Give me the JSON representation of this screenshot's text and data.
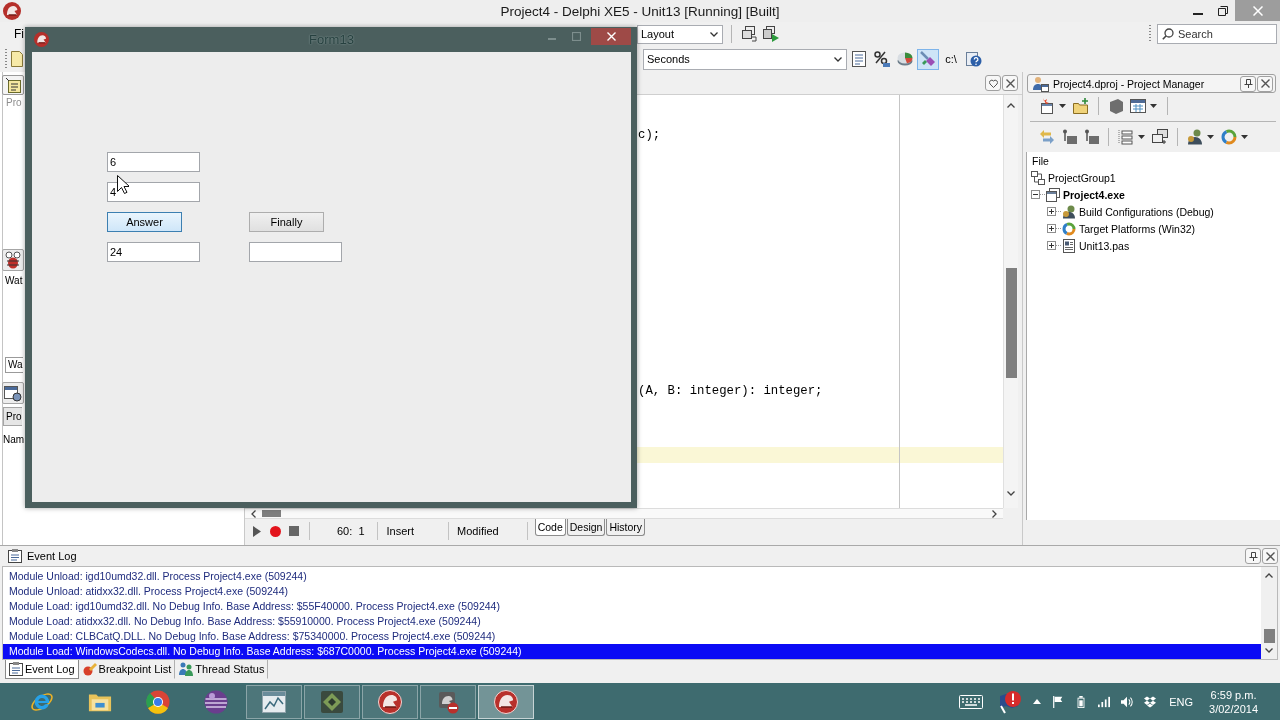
{
  "window": {
    "title": "Project4 - Delphi XE5 - Unit13 [Running] [Built]"
  },
  "menu_bar": {
    "items": [
      "Fi"
    ]
  },
  "toolbar": {
    "layout_combo": {
      "value": "Layout"
    },
    "search": {
      "placeholder": "Search"
    }
  },
  "debug_toolbar": {
    "combo": {
      "value": "Seconds"
    },
    "buttons": [
      {
        "kind": "page",
        "selected": false
      },
      {
        "kind": "percent",
        "selected": false
      },
      {
        "kind": "pie",
        "selected": false
      },
      {
        "kind": "tools",
        "selected": true
      },
      {
        "kind": "text",
        "label": "c:\\",
        "selected": false
      },
      {
        "kind": "help",
        "selected": false
      }
    ]
  },
  "left_strip": [
    {
      "kind": "dim",
      "text": "Pro"
    },
    {
      "kind": "caption",
      "text": "Wat"
    },
    {
      "kind": "tab",
      "text": "Wa"
    },
    {
      "kind": "button",
      "text": "Pro"
    },
    {
      "kind": "caption",
      "text": "Nam"
    }
  ],
  "form": {
    "title": "Form13",
    "rows": [
      [
        {
          "kind": "edit",
          "value": "6"
        }
      ],
      [
        {
          "kind": "edit",
          "value": "4"
        }
      ],
      [
        {
          "kind": "button",
          "label": "Answer",
          "focused": true
        },
        {
          "kind": "button",
          "label": "Finally",
          "focused": false
        }
      ],
      [
        {
          "kind": "edit",
          "value": "24"
        },
        {
          "kind": "edit"
        }
      ]
    ]
  },
  "editor": {
    "code_lines": [
      {
        "text": "c);"
      },
      {
        "text": "(A, B: integer): integer;"
      }
    ],
    "status_bar": {
      "cursor_position": "60:  1",
      "insert_mode": "Insert",
      "modified": "Modified",
      "tabs": [
        {
          "label": "Code",
          "selected": true
        },
        {
          "label": "Design",
          "selected": false
        },
        {
          "label": "History",
          "selected": false
        }
      ]
    }
  },
  "project_manager": {
    "title": "Project4.dproj - Project Manager",
    "column": "File",
    "tree": [
      {
        "kind": "group",
        "label": "ProjectGroup1",
        "children": [
          {
            "kind": "project",
            "label": "Project4.exe",
            "active": true,
            "expanded": true,
            "children": [
              {
                "kind": "configurations",
                "label": "Build Configurations (Debug)",
                "expanded": false
              },
              {
                "kind": "platforms",
                "label": "Target Platforms (Win32)",
                "expanded": false
              },
              {
                "kind": "unit",
                "label": "Unit13.pas",
                "expanded": false
              }
            ]
          }
        ]
      }
    ]
  },
  "event_log": {
    "title": "Event Log",
    "entries": [
      {
        "text": "Module Unload: igd10umd32.dll. Process Project4.exe (509244)",
        "selected": false
      },
      {
        "text": "Module Unload: atidxx32.dll. Process Project4.exe (509244)",
        "selected": false
      },
      {
        "text": "Module Load: igd10umd32.dll. No Debug Info. Base Address: $55F40000. Process Project4.exe (509244)",
        "selected": false
      },
      {
        "text": "Module Load: atidxx32.dll. No Debug Info. Base Address: $55910000. Process Project4.exe (509244)",
        "selected": false
      },
      {
        "text": "Module Load: CLBCatQ.DLL. No Debug Info. Base Address: $75340000. Process Project4.exe (509244)",
        "selected": false
      },
      {
        "text": "Module Load: WindowsCodecs.dll. No Debug Info. Base Address: $687C0000. Process Project4.exe (509244)",
        "selected": true
      }
    ],
    "tabs": [
      {
        "label": "Event Log",
        "selected": true
      },
      {
        "label": "Breakpoint List",
        "selected": false
      },
      {
        "label": "Thread Status",
        "selected": false
      }
    ]
  },
  "taskbar": {
    "apps": [
      {
        "kind": "e_logo",
        "running": false,
        "selected": false
      },
      {
        "kind": "folder",
        "running": false,
        "selected": false
      },
      {
        "kind": "circle_logo",
        "running": false,
        "selected": false
      },
      {
        "kind": "sphere",
        "running": false,
        "selected": false
      },
      {
        "kind": "chart",
        "running": true,
        "selected": false
      },
      {
        "kind": "diamond",
        "running": true,
        "selected": false
      },
      {
        "kind": "helmet",
        "running": true,
        "selected": false
      },
      {
        "kind": "helmet_box",
        "running": true,
        "selected": false
      },
      {
        "kind": "helmet",
        "running": true,
        "selected": true
      }
    ],
    "tray": {
      "language": "ENG",
      "time": "6:59 p.m.",
      "date": "3/02/2014"
    }
  }
}
